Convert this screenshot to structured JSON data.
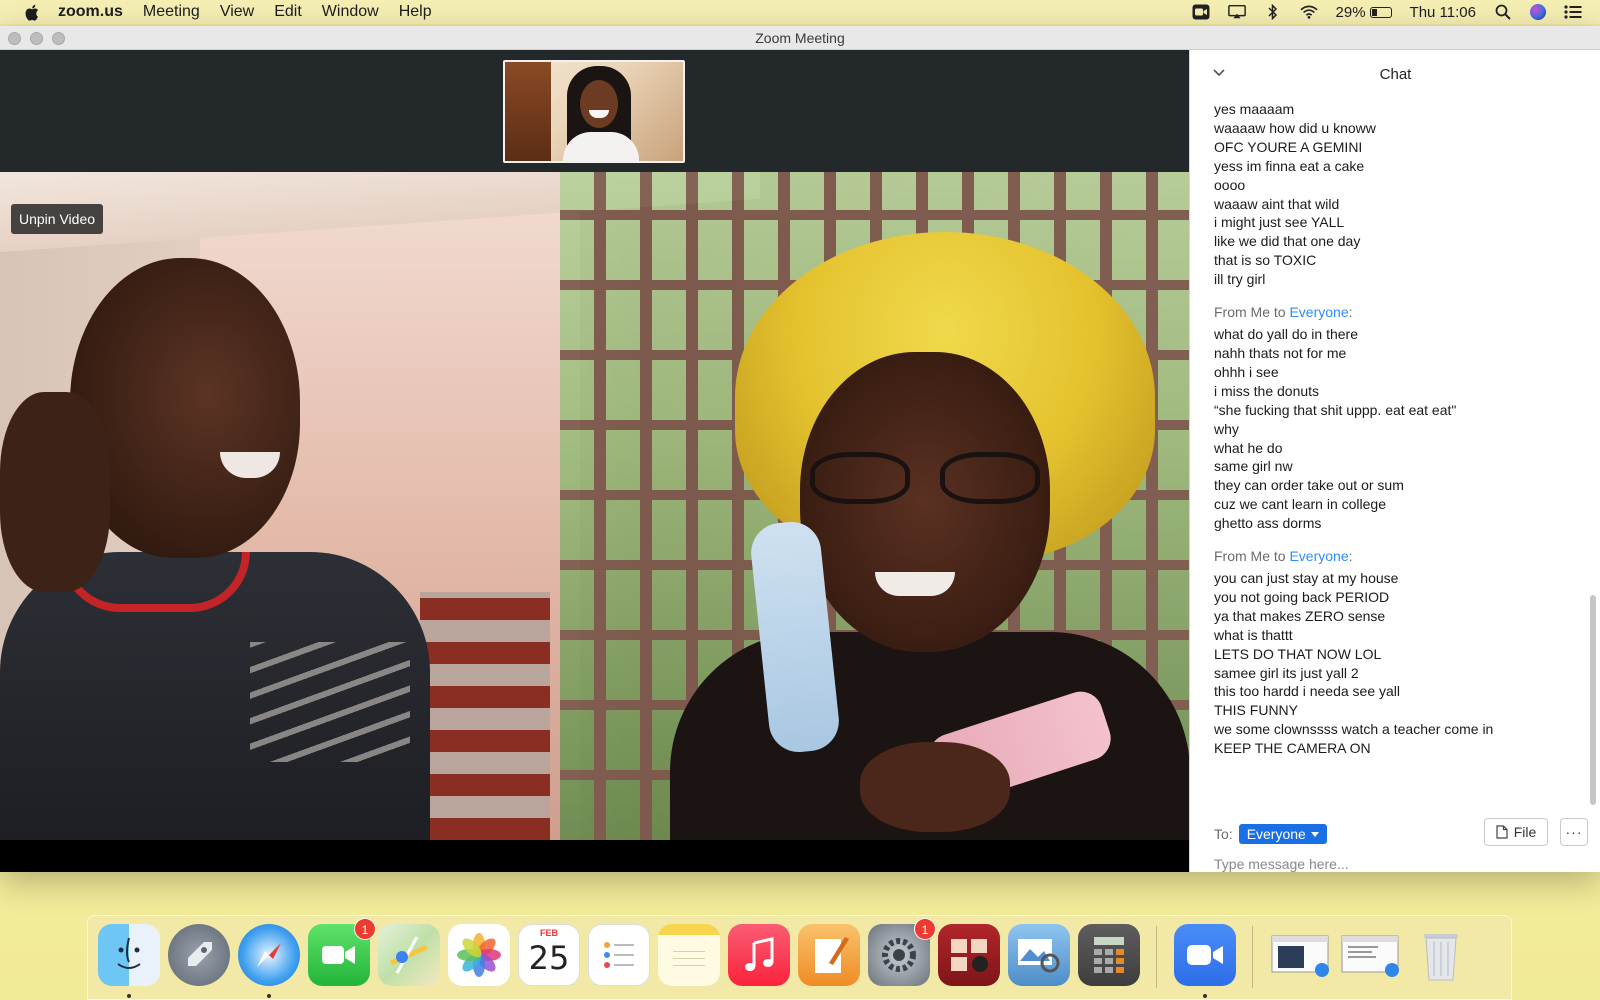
{
  "menubar": {
    "app_name": "zoom.us",
    "menus": [
      "Meeting",
      "View",
      "Edit",
      "Window",
      "Help"
    ],
    "battery_percent": "29%",
    "clock": "Thu 11:06"
  },
  "window": {
    "title": "Zoom Meeting"
  },
  "video": {
    "unpin_label": "Unpin Video"
  },
  "chat": {
    "title": "Chat",
    "groups": [
      {
        "lines": [
          "yes maaaam",
          "waaaaw how did u knoww",
          "OFC YOURE A GEMINI",
          "yess im finna eat a cake",
          "oooo",
          "waaaw aint that wild",
          "i might just see YALL",
          "like we did that one day",
          "that is so TOXIC",
          "ill try girl"
        ]
      },
      {
        "from_prefix": "From Me to",
        "from_target": "Everyone",
        "from_suffix": ":",
        "lines": [
          "what do yall do in there",
          "nahh thats not for me",
          "ohhh i see",
          "i miss the donuts",
          "“she fucking that shit uppp. eat eat eat\"",
          "why",
          "what he do",
          "same girl nw",
          "they can order take out or sum",
          "cuz we cant learn in college",
          "ghetto ass dorms"
        ]
      },
      {
        "from_prefix": "From Me to",
        "from_target": "Everyone",
        "from_suffix": ":",
        "lines": [
          "you can just stay at my house",
          "you not going back PERIOD",
          "ya that makes ZERO sense",
          "what is thattt",
          "LETS DO THAT NOW LOL",
          "samee girl its just yall 2",
          "this too hardd i needa see yall",
          "THIS FUNNY",
          "we some clownssss watch a teacher come in",
          "KEEP THE CAMERA ON"
        ]
      }
    ],
    "to_label": "To:",
    "to_value": "Everyone",
    "file_label": "File",
    "more_label": "···",
    "input_placeholder": "Type message here..."
  },
  "dock": {
    "calendar_month": "FEB",
    "calendar_day": "25",
    "facetime_badge": "1",
    "settings_badge": "1",
    "icons": [
      "finder-icon",
      "launchpad-icon",
      "safari-icon",
      "facetime-icon",
      "maps-icon",
      "photos-icon",
      "calendar-icon",
      "reminders-icon",
      "notes-icon",
      "music-icon",
      "pages-icon",
      "system-preferences-icon",
      "photo-booth-icon",
      "preview-icon",
      "calculator-icon",
      "zoom-icon",
      "safari-window-icon",
      "document-window-icon",
      "trash-icon"
    ]
  }
}
